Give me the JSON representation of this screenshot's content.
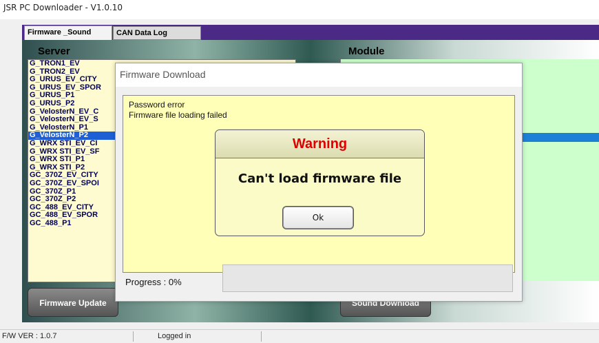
{
  "window": {
    "title": "JSR PC Downloader - V1.0.10"
  },
  "tabs": [
    {
      "label": "Firmware _Sound"
    },
    {
      "label": "CAN Data Log"
    }
  ],
  "server": {
    "label": "Server",
    "items": [
      "G_TRON1_EV",
      "G_TRON2_EV",
      "G_URUS_EV_CITY",
      "G_URUS_EV_SPOR",
      "G_URUS_P1",
      "G_URUS_P2",
      "G_VelosterN_EV_C",
      "G_VelosterN_EV_S",
      "G_VelosterN_P1",
      "G_VelosterN_P2",
      "G_WRX STI_EV_CI",
      "G_WRX STI_EV_SF",
      "G_WRX STI_P1",
      "G_WRX STI_P2",
      "GC_370Z_EV_CITY",
      "GC_370Z_EV_SPOI",
      "GC_370Z_P1",
      "GC_370Z_P2",
      "GC_488_EV_CITY",
      "GC_488_EV_SPOR",
      "GC_488_P1"
    ],
    "selected_index": 9
  },
  "module": {
    "label": "Module",
    "first_item": ""
  },
  "buttons": {
    "firmware_update": "Firmware Update",
    "sound_download": "Sound Download"
  },
  "status": {
    "fw_version": "F/W VER : 1.0.7",
    "login": "Logged in"
  },
  "modal": {
    "title": "Firmware Download",
    "message_line1": "Password error",
    "message_line2": "Firmware file loading failed",
    "progress_label": "Progress : 0%",
    "progress_value": 0
  },
  "warning": {
    "title": "Warning",
    "message": "Can't load firmware file",
    "ok_label": "Ok"
  },
  "colors": {
    "tab_strip": "#4b2a86",
    "server_list_bg": "#fffbd0",
    "module_list_bg": "#ccffcc",
    "selected_row": "#1e5fd6",
    "warning_text": "#e00000",
    "message_box_bg": "#ffffb8"
  }
}
